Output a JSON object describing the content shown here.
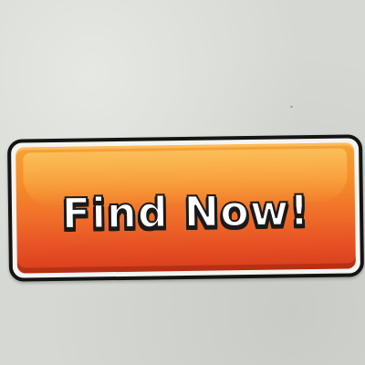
{
  "button": {
    "label": "Find Now!"
  },
  "colors": {
    "background": "#d6d8d3",
    "button_top": "#f7a234",
    "button_bottom": "#d83d1d",
    "outline": "#141414",
    "rim": "#f4f4f2",
    "label_fill": "#ffffff",
    "label_stroke": "#1a1a1a"
  }
}
